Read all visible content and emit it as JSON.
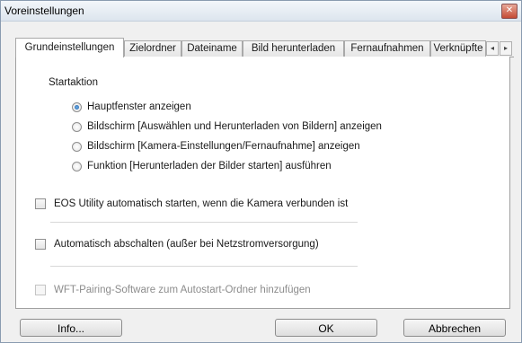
{
  "window": {
    "title": "Voreinstellungen",
    "close_label": "✕"
  },
  "tabs": [
    {
      "label": "Grundeinstellungen",
      "active": true
    },
    {
      "label": "Zielordner"
    },
    {
      "label": "Dateiname"
    },
    {
      "label": "Bild herunterladen"
    },
    {
      "label": "Fernaufnahmen"
    },
    {
      "label": "Verknüpfte"
    }
  ],
  "tab_scroll": {
    "left": "◂",
    "right": "▸"
  },
  "startaktion": {
    "label": "Startaktion",
    "options": [
      {
        "label": "Hauptfenster anzeigen",
        "selected": true
      },
      {
        "label": "Bildschirm [Auswählen und Herunterladen von Bildern] anzeigen",
        "selected": false
      },
      {
        "label": "Bildschirm [Kamera-Einstellungen/Fernaufnahme] anzeigen",
        "selected": false
      },
      {
        "label": "Funktion [Herunterladen der Bilder starten] ausführen",
        "selected": false
      }
    ]
  },
  "checkboxes": [
    {
      "label": "EOS Utility automatisch starten, wenn die Kamera verbunden ist",
      "checked": false,
      "enabled": true
    },
    {
      "label": "Automatisch abschalten (außer bei Netzstromversorgung)",
      "checked": false,
      "enabled": true
    },
    {
      "label": "WFT-Pairing-Software zum Autostart-Ordner hinzufügen",
      "checked": false,
      "enabled": false
    }
  ],
  "buttons": {
    "info": "Info...",
    "ok": "OK",
    "cancel": "Abbrechen"
  }
}
